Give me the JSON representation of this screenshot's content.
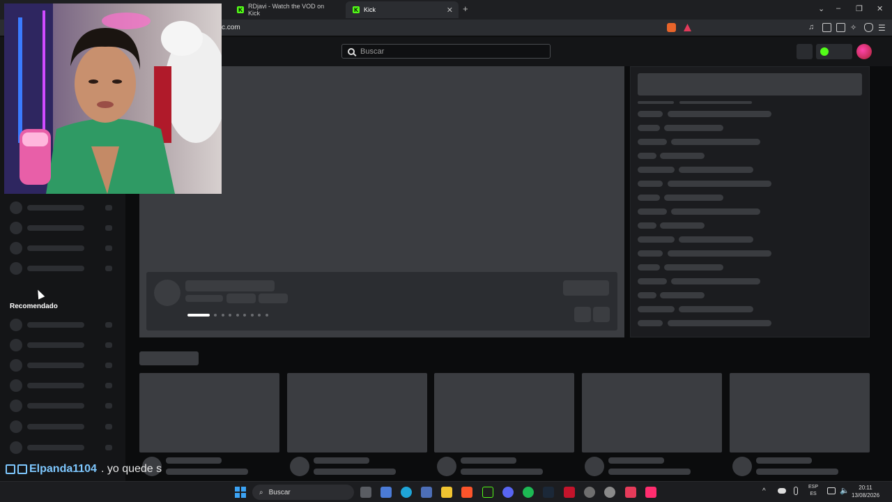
{
  "browser": {
    "tabs": [
      {
        "label": "RDjavi - Watch the VOD on Kick",
        "active": false
      },
      {
        "label": "Kick",
        "active": true
      }
    ],
    "new_tab_label": "+",
    "url": "kick.com",
    "url_visible": "c.com",
    "window_controls": [
      "⌄",
      "–",
      "❐",
      "✕"
    ]
  },
  "kick": {
    "brand_color": "#53fc18",
    "search_placeholder": "Buscar",
    "sidebar": {
      "section_recommended": "Recomendado"
    }
  },
  "chat_overlay": {
    "username": "Elpanda1104",
    "message": ". yo quede s",
    "username_color": "#7ec8ff"
  },
  "taskbar": {
    "search_placeholder": "Buscar",
    "lang_line1": "ESP",
    "lang_line2": "ES",
    "time": "20:11",
    "date": "13/08/2026"
  }
}
